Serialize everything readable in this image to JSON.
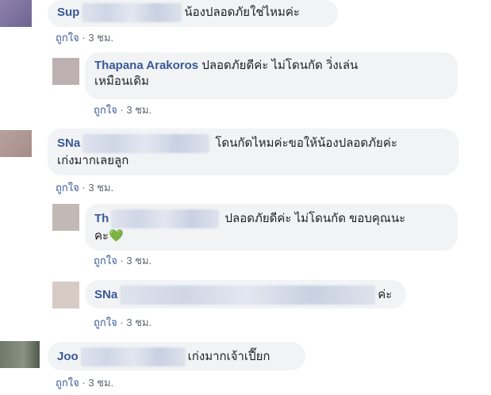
{
  "comments": [
    {
      "name": "Sup",
      "text": "น้องปลอดภัยใช่ไหมค่ะ",
      "like_label": "ถูกใจ",
      "time": "3 ชม.",
      "avatar_color": "#8a7ca6"
    },
    {
      "name": "Thapana Arakoros",
      "text_line1": "ปลอดภัยดีค่ะ ไม่โดนกัด วิ่งเล่น",
      "text_line2": "เหมือนเดิม",
      "like_label": "ถูกใจ",
      "time": "3 ชม.",
      "avatar_color": "#b8aeae"
    },
    {
      "name": "SNa",
      "text_line1": "โดนกัดไหมค่ะขอให้น้องปลอดภัยค่ะ",
      "text_line2": "เก่งมากเลยลูก",
      "like_label": "ถูกใจ",
      "time": "3 ชม.",
      "avatar_color": "#b39b98"
    },
    {
      "name": "Th",
      "text_line1": "ปลอดภัยดีค่ะ ไม่โดนกัด ขอบคุณนะ",
      "text_line2": "คะ",
      "emoji": "💚",
      "like_label": "ถูกใจ",
      "time": "3 ชม.",
      "avatar_color": "#bfb6b4"
    },
    {
      "name": "SNa",
      "text": "ค่ะ",
      "like_label": "ถูกใจ",
      "time": "3 ชม.",
      "avatar_color": "#d6c8c2"
    },
    {
      "name": "Joo",
      "text": "เก่งมากเจ้าเปี๊ยก",
      "like_label": "ถูกใจ",
      "time": "3 ชม.",
      "avatar_color": "#6f7a68"
    }
  ],
  "separator": "·"
}
